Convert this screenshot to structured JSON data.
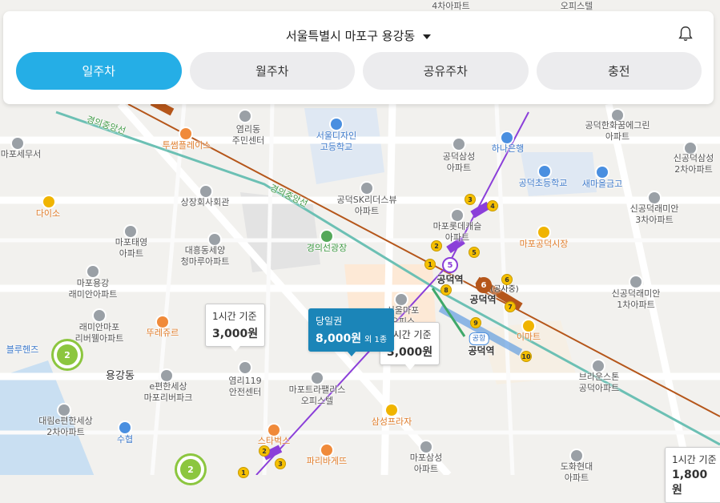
{
  "header": {
    "location": "서울특별시 마포구 용강동",
    "tabs": [
      {
        "label": "일주차",
        "active": true
      },
      {
        "label": "월주차",
        "active": false
      },
      {
        "label": "공유주차",
        "active": false
      },
      {
        "label": "충전",
        "active": false
      }
    ]
  },
  "map": {
    "top_labels": [
      "4차아파트",
      "오피스텔"
    ],
    "places": [
      {
        "name": "마포세무서"
      },
      {
        "name": "투썸플레이스"
      },
      {
        "name": "염리동\n주민센터"
      },
      {
        "name": "서울디자인\n고등학교"
      },
      {
        "name": "공덕삼성\n아파트"
      },
      {
        "name": "하나은행"
      },
      {
        "name": "공덕한화꿈에그린\n아파트"
      },
      {
        "name": "신공덕삼성\n2차아파트"
      },
      {
        "name": "공덕초등학교"
      },
      {
        "name": "새마을금고"
      },
      {
        "name": "다이소"
      },
      {
        "name": "상장회사회관"
      },
      {
        "name": "공덕SK리더스뷰\n아파트"
      },
      {
        "name": "마포롯데캐슬\n아파트"
      },
      {
        "name": "마포공덕시장"
      },
      {
        "name": "신공덕래미안\n3차아파트"
      },
      {
        "name": "마포태영\n아파트"
      },
      {
        "name": "대흥동세양\n청마루아파트"
      },
      {
        "name": "경의선광장"
      },
      {
        "name": "마포용강\n래미안아파트"
      },
      {
        "name": "공덕역"
      },
      {
        "name": "공덕역"
      },
      {
        "name": "신공덕래미안\n1차아파트"
      },
      {
        "name": "래미안마포\n리버웰아파트"
      },
      {
        "name": "뚜레쥬르"
      },
      {
        "name": "서울마포\n오피스"
      },
      {
        "name": "공덕역"
      },
      {
        "name": "이마트"
      },
      {
        "name": "블루헨즈"
      },
      {
        "name": "용강동"
      },
      {
        "name": "e편한세상\n마포리버파크"
      },
      {
        "name": "염리119\n안전센터"
      },
      {
        "name": "마포트라팰리스\n오피스텔"
      },
      {
        "name": "브라운스톤\n공덕아파트"
      },
      {
        "name": "대림e편한세상\n2차아파트"
      },
      {
        "name": "수협"
      },
      {
        "name": "삼성프라자"
      },
      {
        "name": "스타벅스"
      },
      {
        "name": "파리바게뜨"
      },
      {
        "name": "마포삼성\n아파트"
      },
      {
        "name": "도화현대\n아파트"
      },
      {
        "name": "공항"
      },
      {
        "name": "(공사중)"
      }
    ],
    "rail_labels": [
      "경의중앙선",
      "경의중앙선"
    ],
    "clusters": [
      "2",
      "2"
    ],
    "bubbles": [
      {
        "label": "1시간 기준",
        "price": "3,000원"
      },
      {
        "label": "당일권",
        "price": "8,000원",
        "extra": "외 1종"
      },
      {
        "label": "1시간 기준",
        "price": "3,000원"
      },
      {
        "label": "1시간 기준",
        "price": "1,800원"
      }
    ],
    "station_numbers": [
      "5",
      "6",
      "5",
      "6"
    ],
    "exits": [
      "1",
      "2",
      "3",
      "4",
      "5",
      "6",
      "7",
      "8",
      "9",
      "10",
      "2",
      "3",
      "1"
    ]
  },
  "colors": {
    "accent": "#25aee6",
    "line5": "#8b3fd9",
    "line6": "#b5561a",
    "gyeongui": "#6cc0b4",
    "cluster": "#8cc63f"
  }
}
